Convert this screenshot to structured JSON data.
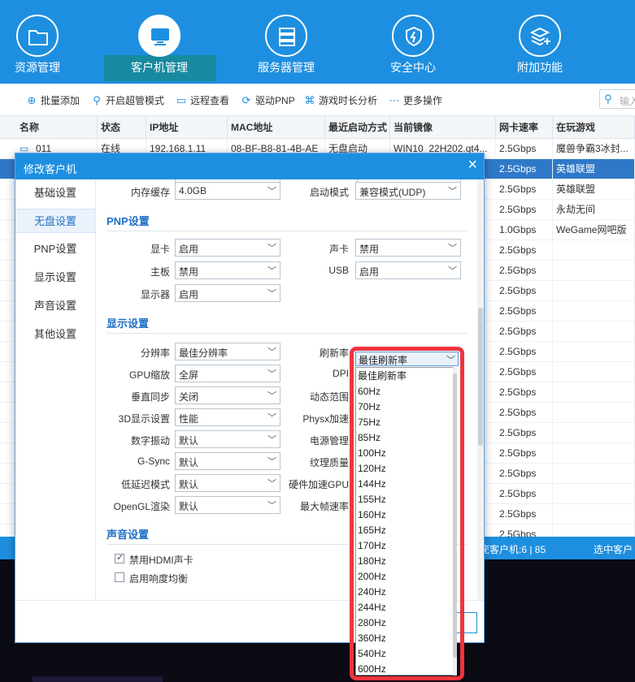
{
  "nav": {
    "items": [
      {
        "label": "资源管理",
        "icon": "folder-icon"
      },
      {
        "label": "客户机管理",
        "icon": "monitor-icon"
      },
      {
        "label": "服务器管理",
        "icon": "server-icon"
      },
      {
        "label": "安全中心",
        "icon": "shield-icon"
      },
      {
        "label": "附加功能",
        "icon": "layers-plus-icon"
      }
    ]
  },
  "toolbar": {
    "batch_add": "批量添加",
    "super_admin": "开启超管模式",
    "remote_view": "远程查看",
    "driver_pnp": "驱动PNP",
    "game_time": "游戏时长分析",
    "more_ops": "更多操作",
    "search_placeholder": "输入"
  },
  "table": {
    "headers": [
      "名称",
      "状态",
      "IP地址",
      "MAC地址",
      "最近启动方式",
      "当前镜像",
      "网卡速率",
      "在玩游戏"
    ],
    "first_row": [
      "011",
      "在线",
      "192.168.1.11",
      "08-BF-B8-81-4B-AE",
      "无盘启动",
      "WIN10_22H202.qt4...",
      "2.5Gbps",
      "魔兽争霸3冰封..."
    ],
    "speed_rows": [
      {
        "speed": "2.5Gbps",
        "game": "英雄联盟"
      },
      {
        "speed": "2.5Gbps",
        "game": "英雄联盟"
      },
      {
        "speed": "2.5Gbps",
        "game": "永劫无间"
      },
      {
        "speed": "1.0Gbps",
        "game": "WeGame网吧版"
      },
      {
        "speed": "2.5Gbps",
        "game": ""
      },
      {
        "speed": "2.5Gbps",
        "game": ""
      },
      {
        "speed": "2.5Gbps",
        "game": ""
      },
      {
        "speed": "2.5Gbps",
        "game": ""
      },
      {
        "speed": "2.5Gbps",
        "game": ""
      },
      {
        "speed": "2.5Gbps",
        "game": ""
      },
      {
        "speed": "2.5Gbps",
        "game": ""
      },
      {
        "speed": "2.5Gbps",
        "game": ""
      },
      {
        "speed": "2.5Gbps",
        "game": ""
      },
      {
        "speed": "2.5Gbps",
        "game": ""
      },
      {
        "speed": "2.5Gbps",
        "game": ""
      },
      {
        "speed": "2.5Gbps",
        "game": ""
      },
      {
        "speed": "2.5Gbps",
        "game": ""
      },
      {
        "speed": "2.5Gbps",
        "game": ""
      },
      {
        "speed": "2.5Gbps",
        "game": ""
      }
    ]
  },
  "statusbar": {
    "clients": "疣客户机:6 | 85",
    "selected": "选中客户"
  },
  "dialog": {
    "title": "修改客户机",
    "side": [
      "基础设置",
      "无盘设置",
      "PNP设置",
      "显示设置",
      "声音设置",
      "其他设置"
    ],
    "top_row": {
      "mem_label": "内存缓存",
      "mem_value": "4.0GB",
      "boot_label": "启动模式",
      "boot_value": "兼容模式(UDP)"
    },
    "pnp": {
      "title": "PNP设置",
      "gpu_label": "显卡",
      "gpu_value": "启用",
      "sound_label": "声卡",
      "sound_value": "禁用",
      "board_label": "主板",
      "board_value": "禁用",
      "usb_label": "USB",
      "usb_value": "启用",
      "monitor_label": "显示器",
      "monitor_value": "启用"
    },
    "display": {
      "title": "显示设置",
      "left": [
        {
          "label": "分辨率",
          "value": "最佳分辨率"
        },
        {
          "label": "GPU缩放",
          "value": "全屏"
        },
        {
          "label": "垂直同步",
          "value": "关闭"
        },
        {
          "label": "3D显示设置",
          "value": "性能"
        },
        {
          "label": "数字振动",
          "value": "默认"
        },
        {
          "label": "G-Sync",
          "value": "默认"
        },
        {
          "label": "低延迟模式",
          "value": "默认"
        },
        {
          "label": "OpenGL渲染",
          "value": "默认"
        }
      ],
      "right_labels": [
        "刷新率",
        "DPI",
        "动态范围",
        "Physx加速",
        "电源管理",
        "纹理质量",
        "硬件加速GPU",
        "最大帧速率"
      ]
    },
    "sound": {
      "title": "声音设置",
      "hdmi_label": "禁用HDMI声卡",
      "loudness_label": "启用响度均衡"
    }
  },
  "dropdown": {
    "selected": "最佳刷新率",
    "options": [
      "最佳刷新率",
      "60Hz",
      "70Hz",
      "75Hz",
      "85Hz",
      "100Hz",
      "120Hz",
      "144Hz",
      "155Hz",
      "160Hz",
      "165Hz",
      "170Hz",
      "180Hz",
      "200Hz",
      "240Hz",
      "244Hz",
      "280Hz",
      "360Hz",
      "540Hz",
      "600Hz"
    ]
  },
  "colors": {
    "brand": "#1e8fe0",
    "selected_row": "#2f78c8",
    "highlight_frame": "#f0343c"
  }
}
